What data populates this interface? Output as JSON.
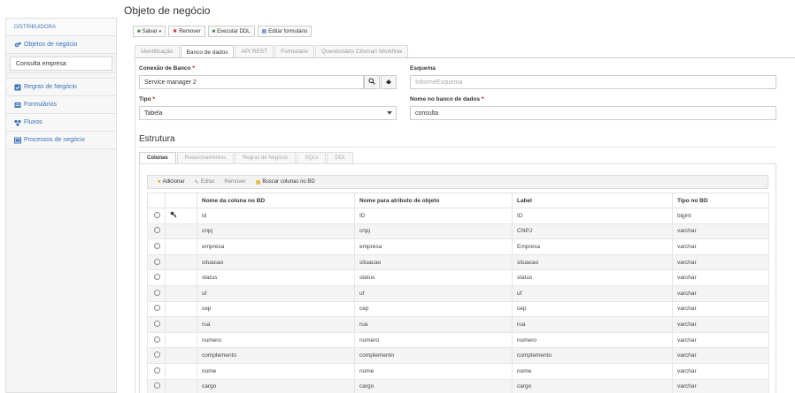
{
  "sidebar": {
    "header": "DISTRIBUIDORA",
    "items": [
      {
        "label": "Objetos de negócio",
        "icon": "cogs-icon"
      },
      {
        "label": "Regras de Negócio",
        "icon": "check-square-icon"
      },
      {
        "label": "Formulários",
        "icon": "form-icon"
      },
      {
        "label": "Fluxos",
        "icon": "sitemap-icon"
      },
      {
        "label": "Processos de negócio",
        "icon": "process-icon"
      }
    ],
    "selected_object": "Consulta empresa"
  },
  "page": {
    "title": "Objeto de negócio"
  },
  "toolbar": {
    "save": "Salvar",
    "remove": "Remover",
    "execute_ddl": "Executar DDL",
    "edit_form": "Editar formulário"
  },
  "tabs": [
    "Identificação",
    "Banco de dados",
    "API REST",
    "Formulário",
    "Questionário Citsmart Workflow"
  ],
  "form": {
    "connection_label": "Conexão de Banco",
    "connection_value": "Service manager 2",
    "schema_label": "Esquema",
    "schema_placeholder": "InformeEsquema",
    "type_label": "Tipo",
    "type_value": "Tabela",
    "dbname_label": "Nome no banco de dados",
    "dbname_value": "consulta",
    "required_mark": "*"
  },
  "structure": {
    "title": "Estrutura",
    "subtabs": [
      "Colunas",
      "Relacionamentos",
      "Regras de Negócio",
      "SQLs",
      "DDL"
    ],
    "grid_actions": {
      "add": "Adicionar",
      "edit": "Editar",
      "remove": "Remover",
      "fetch": "Buscar colunas no BD"
    },
    "columns": [
      "Nome da coluna no BD",
      "Nome para atributo de objeto",
      "Label",
      "Tipo no BD"
    ],
    "rows": [
      {
        "col": "id",
        "attr": "ID",
        "label": "ID",
        "type": "bigint",
        "key": true
      },
      {
        "col": "cnpj",
        "attr": "cnpj",
        "label": "CNPJ",
        "type": "varchar"
      },
      {
        "col": "empresa",
        "attr": "empresa",
        "label": "Empresa",
        "type": "varchar"
      },
      {
        "col": "situacao",
        "attr": "situacao",
        "label": "situacao",
        "type": "varchar"
      },
      {
        "col": "status",
        "attr": "status",
        "label": "status",
        "type": "varchar"
      },
      {
        "col": "uf",
        "attr": "uf",
        "label": "uf",
        "type": "varchar"
      },
      {
        "col": "cep",
        "attr": "cep",
        "label": "cep",
        "type": "varchar"
      },
      {
        "col": "rua",
        "attr": "rua",
        "label": "rua",
        "type": "varchar"
      },
      {
        "col": "numero",
        "attr": "numero",
        "label": "numero",
        "type": "varchar"
      },
      {
        "col": "complemento",
        "attr": "complemento",
        "label": "complemento",
        "type": "varchar"
      },
      {
        "col": "nome",
        "attr": "nome",
        "label": "nome",
        "type": "varchar"
      },
      {
        "col": "cargo",
        "attr": "cargo",
        "label": "cargo",
        "type": "varchar"
      }
    ]
  }
}
